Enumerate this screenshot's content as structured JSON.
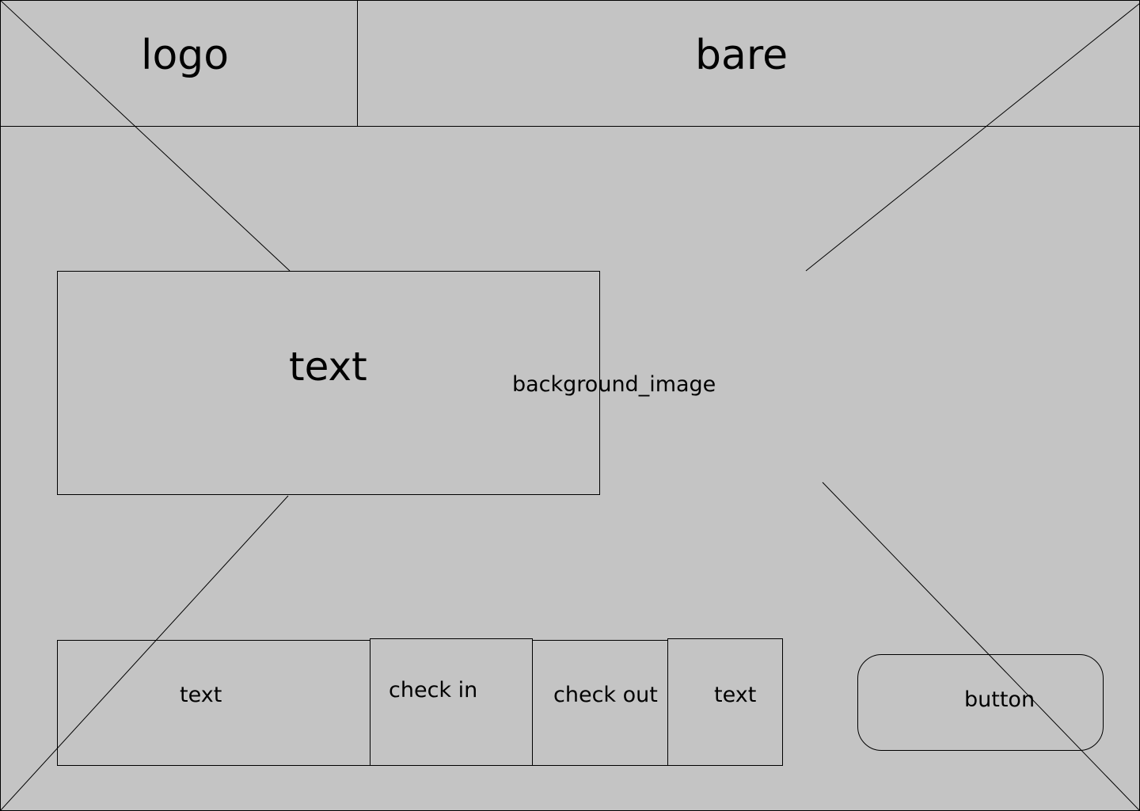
{
  "header": {
    "logo_label": "logo",
    "bar_label": "bare"
  },
  "hero": {
    "text_label": "text",
    "background_label": "background_image"
  },
  "booking": {
    "text_label": "text",
    "check_in_label": "check in",
    "check_out_label": "check out",
    "guests_label": "text",
    "button_label": "button"
  },
  "colors": {
    "background": "#c4c4c4",
    "stroke": "#000000"
  }
}
